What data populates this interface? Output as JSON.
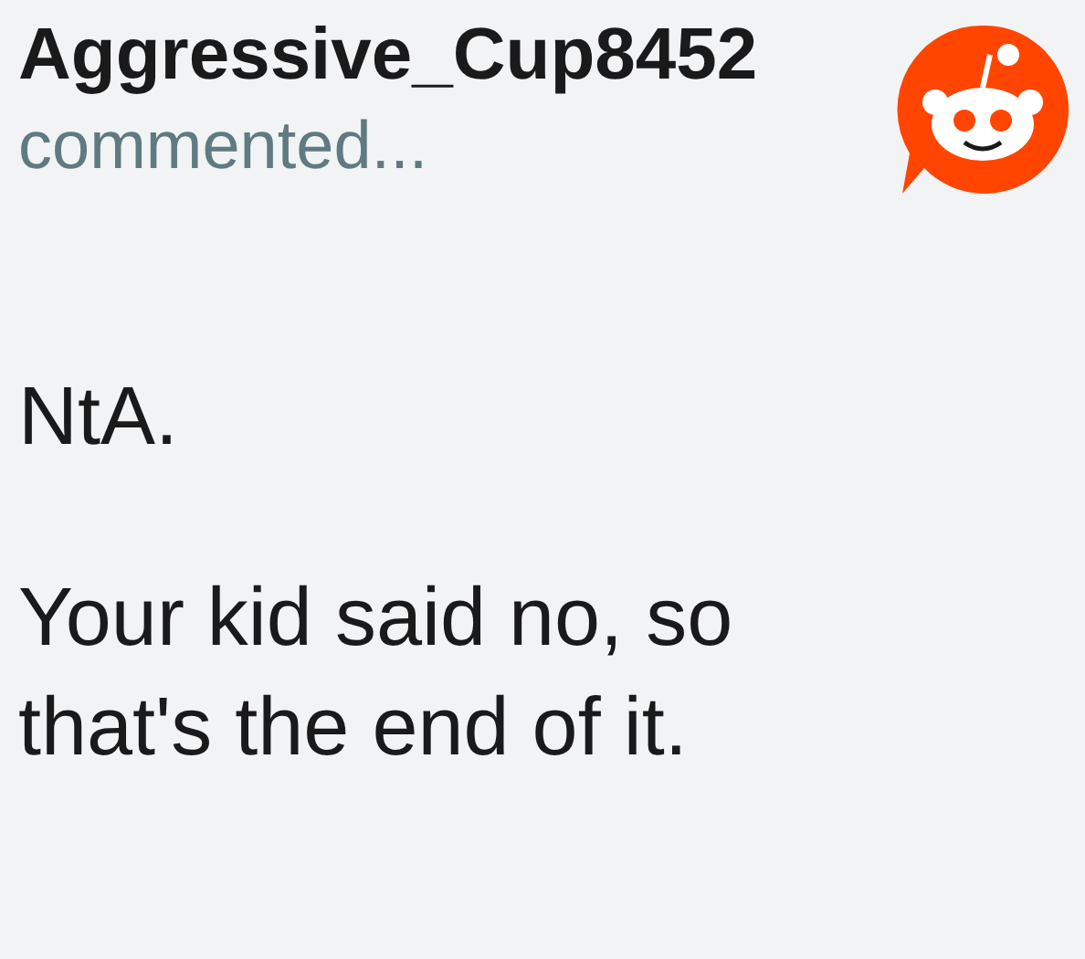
{
  "comment": {
    "author": "Aggressive_Cup8452",
    "action": "commented...",
    "paragraphs": [
      "NtA.",
      "Your kid said no, so that's the end of it."
    ]
  }
}
